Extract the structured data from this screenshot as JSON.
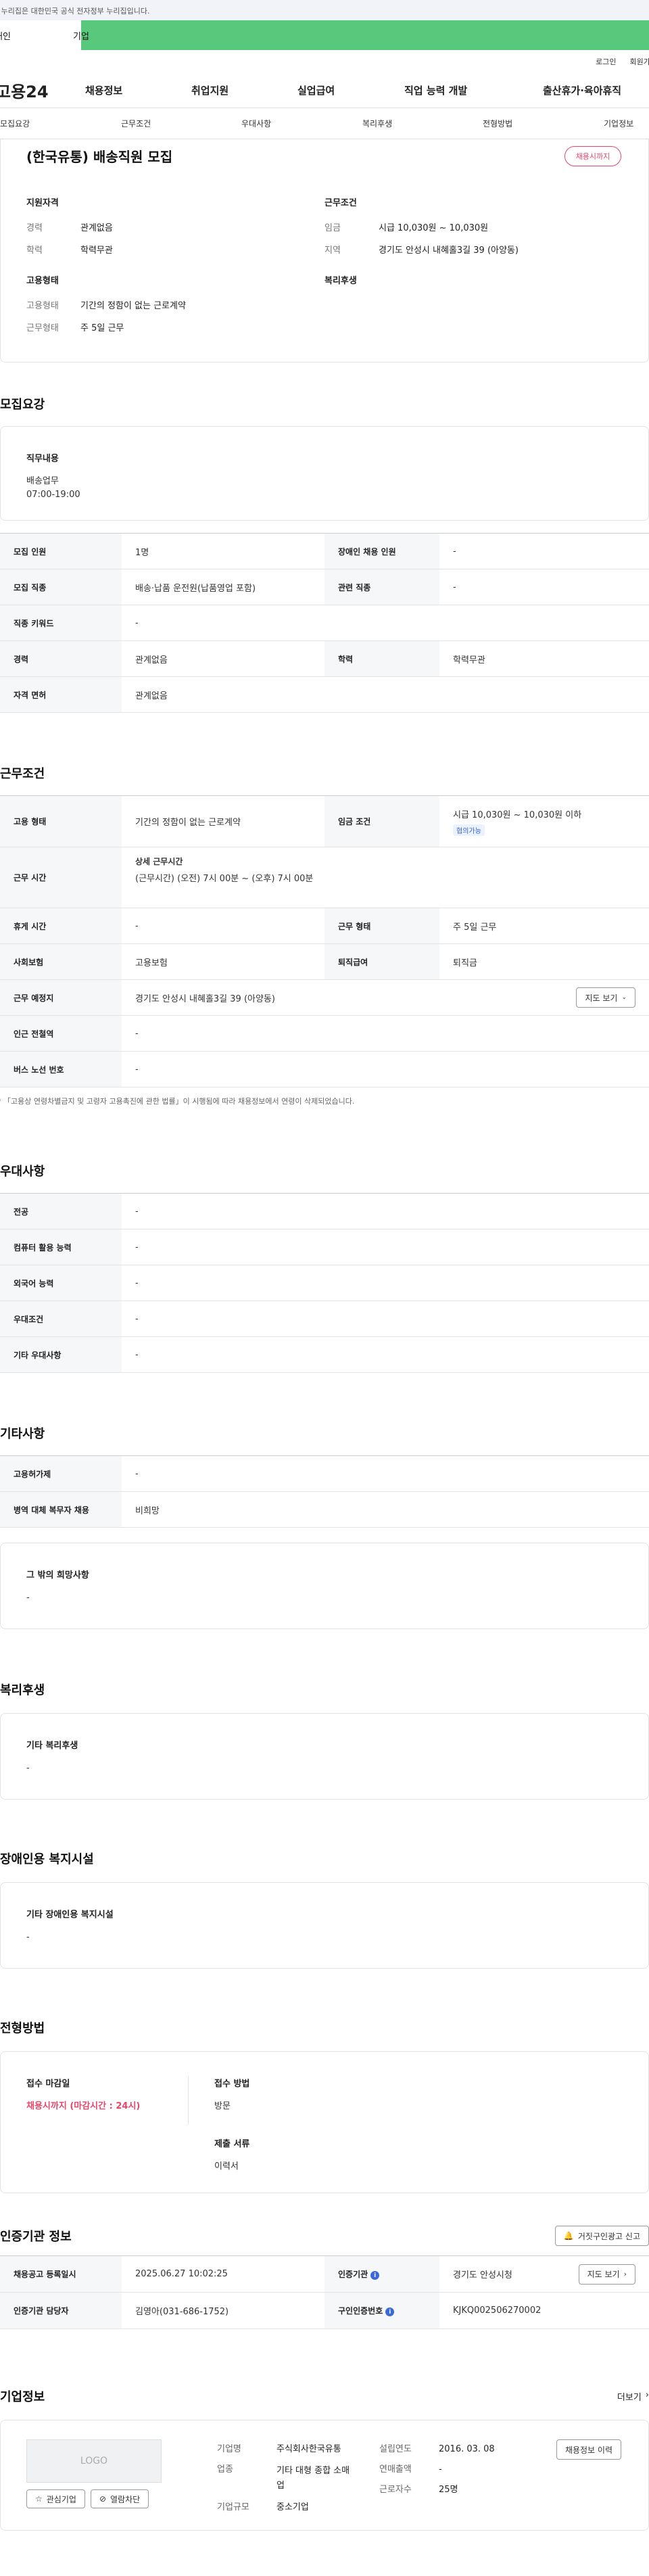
{
  "gov_banner": "이 누리집은 대한민국 공식 전자정부 누리집입니다.",
  "user_tabs": [
    "개인",
    "기업"
  ],
  "util_links": [
    "로그인",
    "회원가입"
  ],
  "logo": "고용24",
  "gnb": [
    "채용정보",
    "취업지원",
    "실업급여",
    "직업 능력 개발",
    "출산휴가·육아휴직"
  ],
  "anchors": [
    "모집요강",
    "근무조건",
    "우대사항",
    "복리후생",
    "전형방법",
    "기업정보"
  ],
  "summary": {
    "title": "(한국유통) 배송직원 모집",
    "status": "채용시까지",
    "qual_head": "지원자격",
    "qual": [
      {
        "k": "경력",
        "v": "관계없음"
      },
      {
        "k": "학력",
        "v": "학력무관"
      }
    ],
    "cond_head": "근무조건",
    "cond": [
      {
        "k": "임금",
        "v": "시급 10,030원 ~ 10,030원"
      },
      {
        "k": "지역",
        "v": "경기도 안성시 내혜홀3길 39 (아양동)"
      }
    ],
    "emp_head": "고용형태",
    "emp": [
      {
        "k": "고용형태",
        "v": "기간의 정함이 없는 근로계약"
      },
      {
        "k": "근무형태",
        "v": "주 5일 근무"
      }
    ],
    "welfare_head": "복리후생"
  },
  "recruit": {
    "title": "모집요강",
    "duty_head": "직무내용",
    "duty_lines": [
      "배송업무",
      "07:00-19:00"
    ],
    "rows": [
      {
        "k1": "모집 인원",
        "v1": "1명",
        "k2": "장애인 채용 인원",
        "v2": "-"
      },
      {
        "k1": "모집 직종",
        "v1": "배송·납품 운전원(납품영업 포함)",
        "k2": "관련 직종",
        "v2": "-"
      },
      {
        "k1": "직종 키워드",
        "v1": "-"
      },
      {
        "k1": "경력",
        "v1": "관계없음",
        "k2": "학력",
        "v2": "학력무관"
      },
      {
        "k1": "자격 면허",
        "v1": "관계없음"
      }
    ]
  },
  "work": {
    "title": "근무조건",
    "employ_type_k": "고용 형태",
    "employ_type_v": "기간의 정함이 없는 근로계약",
    "wage_k": "임금 조건",
    "wage_v": "시급 10,030원 ~ 10,030원 이하",
    "wage_badge": "협의가능",
    "hours_k": "근무 시간",
    "hours_head": "상세 근무시간",
    "hours_v": "(근무시간) (오전) 7시 00분 ~ (오후) 7시 00분",
    "rest_k": "휴게 시간",
    "rest_v": "-",
    "shift_k": "근무 형태",
    "shift_v": "주 5일 근무",
    "ins_k": "사회보험",
    "ins_v": "고용보험",
    "sev_k": "퇴직급여",
    "sev_v": "퇴직금",
    "place_k": "근무 예정지",
    "place_v": "경기도 안성시 내혜홀3길 39 (아양동)",
    "map_btn": "지도 보기",
    "subway_k": "인근 전철역",
    "subway_v": "-",
    "bus_k": "버스 노선 번호",
    "bus_v": "-",
    "note": "* 「고용상 연령차별금지 및 고령자 고용촉진에 관한 법률」이 시행됨에 따라 채용정보에서 연령이 삭제되었습니다."
  },
  "pref": {
    "title": "우대사항",
    "rows": [
      {
        "k": "전공",
        "v": "-"
      },
      {
        "k": "컴퓨터 활용 능력",
        "v": "-"
      },
      {
        "k": "외국어 능력",
        "v": "-"
      },
      {
        "k": "우대조건",
        "v": "-"
      },
      {
        "k": "기타 우대사항",
        "v": "-"
      }
    ]
  },
  "etc": {
    "title": "기타사항",
    "rows": [
      {
        "k": "고용허가제",
        "v": "-"
      },
      {
        "k": "병역 대체 복무자 채용",
        "v": "비희망"
      }
    ],
    "box_head": "그 밖의 희망사항",
    "box_v": "-"
  },
  "welfare": {
    "title": "복리후생",
    "box_head": "기타 복리후생",
    "box_v": "-"
  },
  "disabled": {
    "title": "장애인용 복지시설",
    "box_head": "기타 장애인용 복지시설",
    "box_v": "-"
  },
  "selection": {
    "title": "전형방법",
    "deadline_head": "접수 마감일",
    "deadline_v": "채용시까지 (마감시간 : 24시)",
    "method_head": "접수 방법",
    "method_v": "방문",
    "docs_head": "제출 서류",
    "docs_v": "이력서"
  },
  "agency": {
    "title": "인증기관 정보",
    "report_btn": "거짓구인광고 신고",
    "reg_k": "채용공고 등록일시",
    "reg_v": "2025.06.27 10:02:25",
    "org_k": "인증기관",
    "org_v": "경기도 안성시청",
    "map_btn": "지도 보기",
    "staff_k": "인증기관 담당자",
    "staff_v": "김영아(031-686-1752)",
    "cert_k": "구인인증번호",
    "cert_v": "KJKQ002506270002"
  },
  "company": {
    "title": "기업정보",
    "more": "더보기",
    "logo_text": "LOGO",
    "interest_btn": "관심기업",
    "block_btn": "열람차단",
    "name_k": "기업명",
    "name_v": "주식회사한국유통",
    "ind_k": "업종",
    "ind_v": "기타 대형 종합 소매업",
    "size_k": "기업규모",
    "size_v": "중소기업",
    "year_k": "설립연도",
    "year_v": "2016. 03. 08",
    "sales_k": "연매출액",
    "sales_v": "-",
    "emp_k": "근로자수",
    "emp_v": "25명",
    "history_btn": "채용정보 이력"
  },
  "colors": {
    "green": "#58c97c",
    "pink": "#e8466a",
    "blue": "#3a68d8"
  }
}
